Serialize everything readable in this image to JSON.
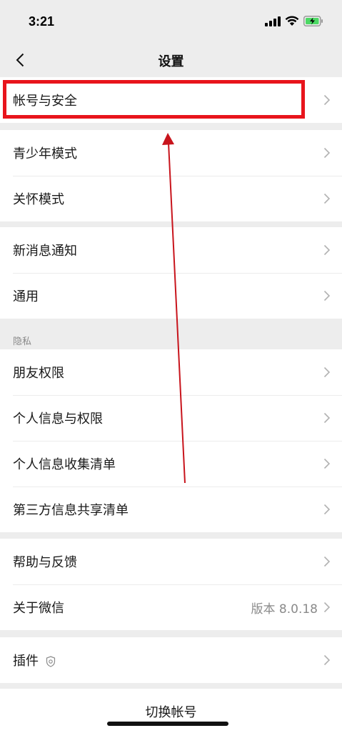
{
  "status_bar": {
    "time": "3:21"
  },
  "nav": {
    "title": "设置"
  },
  "groups": [
    {
      "items": [
        {
          "label": "帐号与安全"
        }
      ]
    },
    {
      "items": [
        {
          "label": "青少年模式"
        },
        {
          "label": "关怀模式"
        }
      ]
    },
    {
      "items": [
        {
          "label": "新消息通知"
        },
        {
          "label": "通用"
        }
      ]
    },
    {
      "header": "隐私",
      "items": [
        {
          "label": "朋友权限"
        },
        {
          "label": "个人信息与权限"
        },
        {
          "label": "个人信息收集清单"
        },
        {
          "label": "第三方信息共享清单"
        }
      ]
    },
    {
      "items": [
        {
          "label": "帮助与反馈"
        },
        {
          "label": "关于微信",
          "value": "版本 8.0.18"
        }
      ]
    },
    {
      "items": [
        {
          "label": "插件"
        }
      ]
    }
  ],
  "footer": {
    "switch_account": "切换帐号"
  },
  "colors": {
    "background": "#ededed",
    "highlight": "#e8141c",
    "arrow": "#c8141c"
  }
}
